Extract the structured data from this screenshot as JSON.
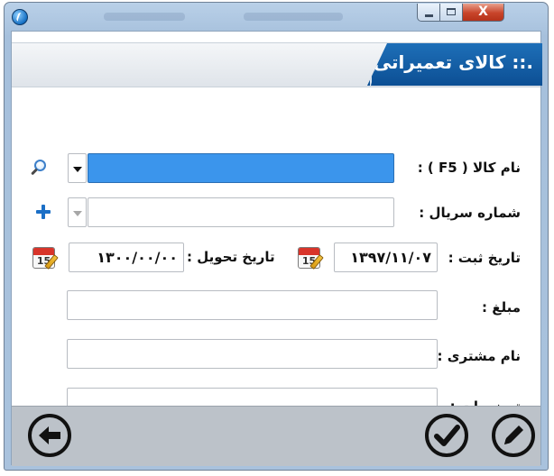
{
  "window": {
    "controls": {
      "close_label": "X"
    }
  },
  "header": {
    "title": ".:: کالای تعمیراتی"
  },
  "form": {
    "item_name": {
      "label": "نام کالا ( F5 ) :",
      "value": ""
    },
    "serial_number": {
      "label": "شماره سریال :",
      "value": ""
    },
    "registration_date": {
      "label": "تاریخ ثبت :",
      "value": "۱۳۹۷/۱۱/۰۷"
    },
    "delivery_date": {
      "label": "تاریخ تحویل :",
      "value": "۱۳۰۰/۰۰/۰۰"
    },
    "amount": {
      "label": "مبلغ :",
      "value": ""
    },
    "customer_name": {
      "label": "نام مشتری :",
      "value": ""
    },
    "description": {
      "label": "توضیحات :",
      "value": ""
    },
    "calendar_icon_number": "15"
  },
  "icons": {
    "app": "app-icon",
    "search": "search-icon",
    "add": "plus-icon",
    "calendar": "calendar-icon",
    "back": "back-arrow-icon",
    "confirm": "checkmark-icon",
    "edit": "pencil-icon"
  },
  "colors": {
    "selected_field": "#3b95ec",
    "header_tab": "#0c4f94",
    "close_button": "#c8442a",
    "footer": "#bcc2c9"
  }
}
